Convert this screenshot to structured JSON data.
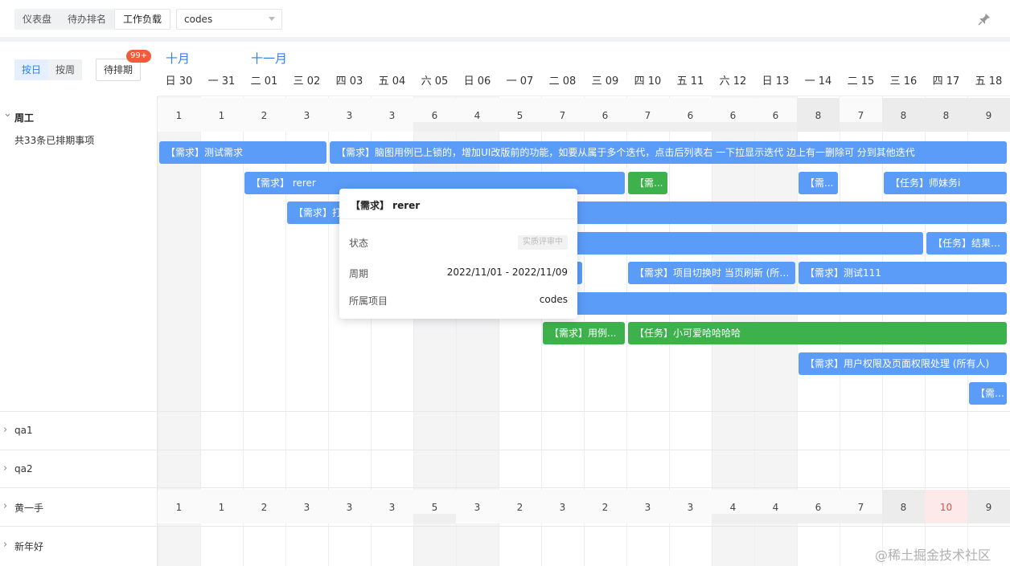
{
  "topbar": {
    "tabs": [
      {
        "label": "仪表盘",
        "active": false
      },
      {
        "label": "待办排名",
        "active": false
      },
      {
        "label": "工作负载",
        "active": true
      }
    ],
    "project_select": "codes",
    "pin_icon": "pin-icon"
  },
  "left_panel": {
    "view_toggle": [
      {
        "label": "按日",
        "active": true
      },
      {
        "label": "按周",
        "active": false
      }
    ],
    "backlog_button": "待排期",
    "backlog_badge": "99+",
    "people": [
      {
        "name": "周工",
        "expanded": true,
        "summary": "共33条已排期事项"
      },
      {
        "name": "qa1",
        "expanded": false
      },
      {
        "name": "qa2",
        "expanded": false
      },
      {
        "name": "黄一手",
        "expanded": false
      },
      {
        "name": "新年好",
        "expanded": false
      }
    ]
  },
  "calendar": {
    "months": [
      {
        "label": "十月",
        "day_index": 0
      },
      {
        "label": "十一月",
        "day_index": 2
      }
    ],
    "days": [
      {
        "label": "日 30",
        "weekend": true
      },
      {
        "label": "一 31",
        "weekend": false
      },
      {
        "label": "二 01",
        "weekend": false
      },
      {
        "label": "三 02",
        "weekend": false
      },
      {
        "label": "四 03",
        "weekend": false
      },
      {
        "label": "五 04",
        "weekend": false
      },
      {
        "label": "六 05",
        "weekend": true
      },
      {
        "label": "日 06",
        "weekend": true
      },
      {
        "label": "一 07",
        "weekend": false
      },
      {
        "label": "二 08",
        "weekend": false
      },
      {
        "label": "三 09",
        "weekend": false
      },
      {
        "label": "四 10",
        "weekend": false
      },
      {
        "label": "五 11",
        "weekend": false
      },
      {
        "label": "六 12",
        "weekend": true
      },
      {
        "label": "日 13",
        "weekend": true
      },
      {
        "label": "一 14",
        "weekend": false
      },
      {
        "label": "二 15",
        "weekend": false
      },
      {
        "label": "三 16",
        "weekend": false
      },
      {
        "label": "四 17",
        "weekend": false
      },
      {
        "label": "五 18",
        "weekend": false
      }
    ],
    "counts_zhou": [
      "1",
      "1",
      "2",
      "3",
      "3",
      "3",
      "6",
      "4",
      "5",
      "7",
      "6",
      "7",
      "6",
      "6",
      "6",
      "8",
      "7",
      "8",
      "8",
      "9"
    ],
    "counts_huang": [
      "1",
      "1",
      "2",
      "3",
      "3",
      "3",
      "5",
      "3",
      "2",
      "3",
      "2",
      "3",
      "3",
      "4",
      "4",
      "6",
      "7",
      "8",
      "10",
      "9"
    ],
    "hot_index_huang": 18
  },
  "bars": [
    {
      "label": "【需求】测试需求",
      "color": "blue",
      "start": 0,
      "span": 4,
      "lane": 0
    },
    {
      "label": "【需求】脑图用例已上锁的，增加UI改版前的功能，如要从属于多个迭代，点击后列表右 一下拉显示迭代 边上有一删除可 分到其他迭代",
      "color": "blue",
      "start": 4,
      "span": 16,
      "lane": 0
    },
    {
      "label": "【需求】 rerer",
      "color": "blue",
      "start": 2,
      "span": 9,
      "lane": 1
    },
    {
      "label": "【需...",
      "color": "green",
      "start": 11,
      "span": 1,
      "lane": 1
    },
    {
      "label": "【需...",
      "color": "blue",
      "start": 15,
      "span": 1,
      "lane": 1
    },
    {
      "label": "【任务】师妹务i",
      "color": "blue",
      "start": 17,
      "span": 3,
      "lane": 1
    },
    {
      "label": "【需求】打",
      "color": "blue",
      "start": 3,
      "span": 17,
      "lane": 2
    },
    {
      "label": "",
      "color": "blue",
      "start": 9,
      "span": 9,
      "lane": 3
    },
    {
      "label": "【任务】结果干...",
      "color": "blue",
      "start": 18,
      "span": 2,
      "lane": 3
    },
    {
      "label": "",
      "color": "blue",
      "start": 9,
      "span": 1,
      "lane": 4
    },
    {
      "label": "【需求】项目切换时 当页刷新 (所有...",
      "color": "blue",
      "start": 11,
      "span": 4,
      "lane": 4
    },
    {
      "label": "【需求】测试111",
      "color": "blue",
      "start": 15,
      "span": 5,
      "lane": 4
    },
    {
      "label": "",
      "color": "blue",
      "start": 9,
      "span": 11,
      "lane": 5
    },
    {
      "label": "【需求】用例...",
      "color": "green",
      "start": 9,
      "span": 2,
      "lane": 6
    },
    {
      "label": "【任务】小可爱哈哈哈哈",
      "color": "green",
      "start": 11,
      "span": 9,
      "lane": 6
    },
    {
      "label": "【需求】用户权限及页面权限处理 (所有人)",
      "color": "blue",
      "start": 15,
      "span": 5,
      "lane": 7
    },
    {
      "label": "【需求】",
      "color": "blue",
      "start": 19,
      "span": 1,
      "lane": 8
    }
  ],
  "popover": {
    "title": "【需求】 rerer",
    "status_label": "状态",
    "status_value": "实质评审中",
    "period_label": "周期",
    "period_value": "2022/11/01 - 2022/11/09",
    "project_label": "所属项目",
    "project_value": "codes"
  },
  "watermark": "@稀土掘金技术社区"
}
